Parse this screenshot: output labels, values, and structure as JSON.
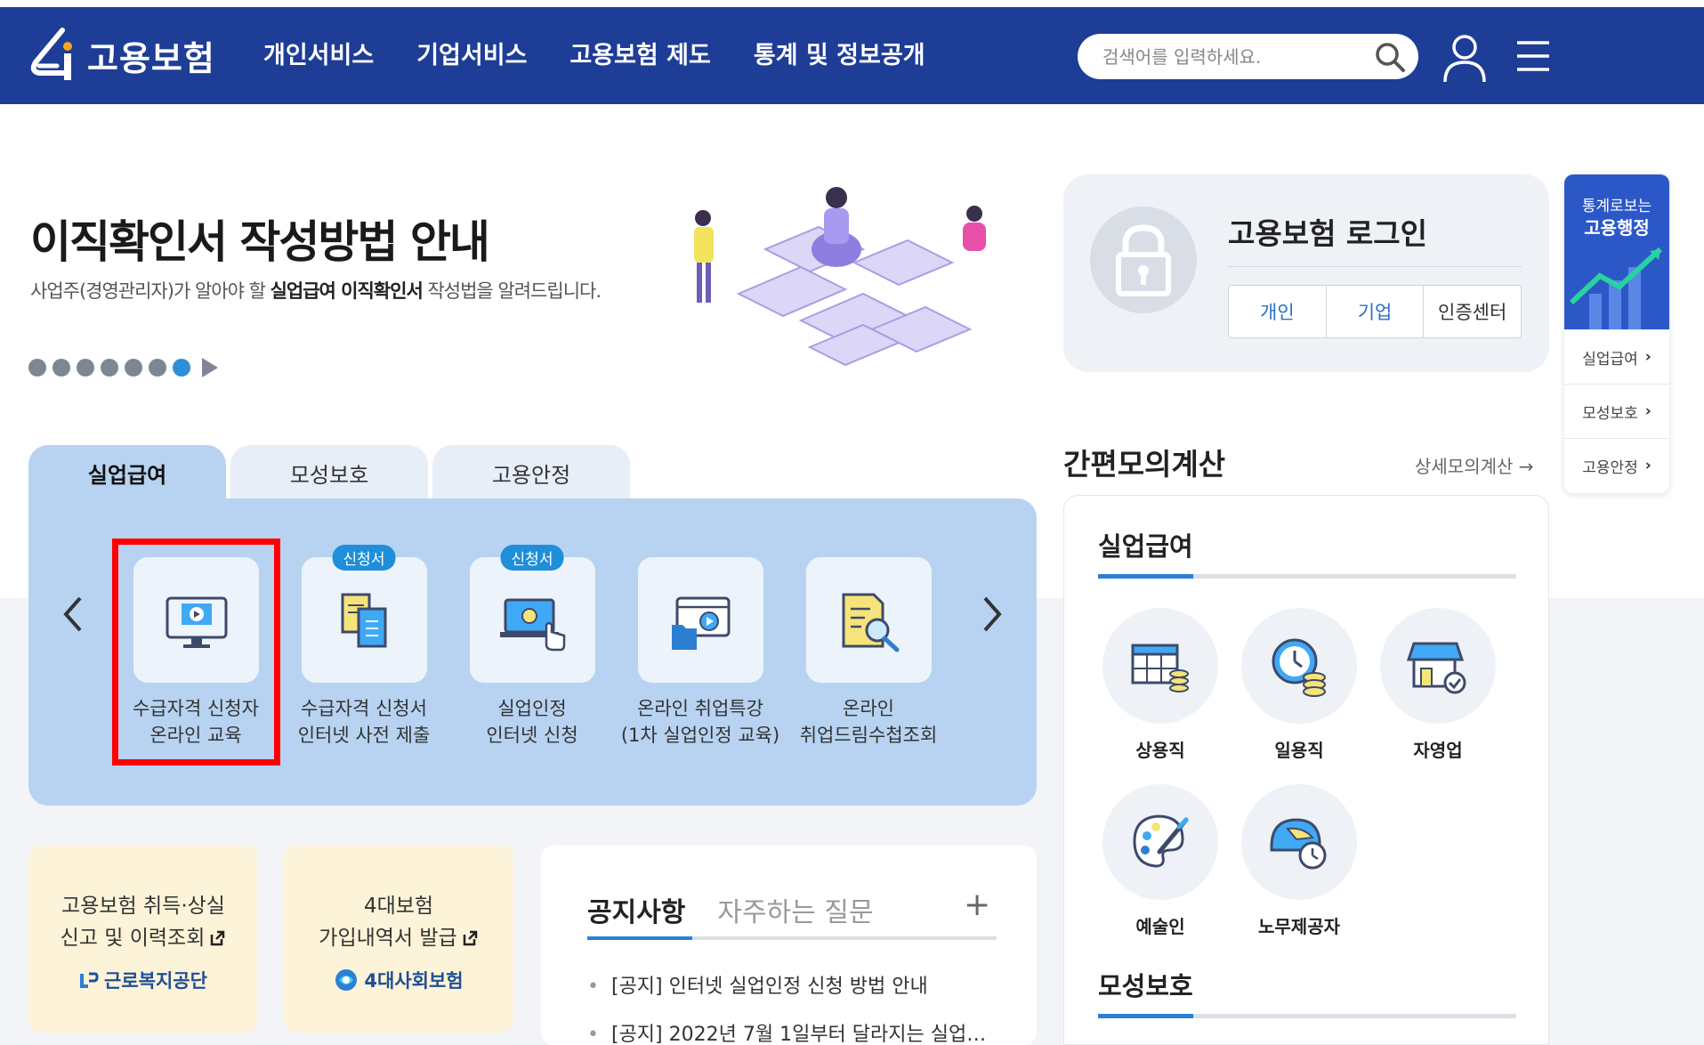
{
  "header": {
    "logo_text": "고용보험",
    "nav": [
      "개인서비스",
      "기업서비스",
      "고용보험 제도",
      "통계 및 정보공개"
    ],
    "search_placeholder": "검색어를 입력하세요."
  },
  "banner": {
    "title": "이직확인서 작성방법 안내",
    "subtitle_pre": "사업주(경영관리자)가 알아야 할 ",
    "subtitle_b1": "실업급여 이직확인서",
    "subtitle_post": " 작성법을 알려드립니다."
  },
  "login": {
    "title": "고용보험 로그인",
    "buttons": [
      "개인",
      "기업",
      "인증센터"
    ]
  },
  "side_widget": {
    "title_line1": "통계로보는",
    "title_line2": "고용행정",
    "items": [
      "실업급여",
      "모성보호",
      "고용안정"
    ]
  },
  "tabs": [
    "실업급여",
    "모성보호",
    "고용안정"
  ],
  "services": [
    {
      "line1": "수급자격 신청자",
      "line2": "온라인 교육",
      "badge": ""
    },
    {
      "line1": "수급자격 신청서",
      "line2": "인터넷 사전 제출",
      "badge": "신청서"
    },
    {
      "line1": "실업인정",
      "line2": "인터넷 신청",
      "badge": "신청서"
    },
    {
      "line1": "온라인 취업특강",
      "line2": "(1차 실업인정 교육)",
      "badge": ""
    },
    {
      "line1": "온라인",
      "line2": "취업드림수첩조회",
      "badge": ""
    }
  ],
  "cards": [
    {
      "line1": "고용보험 취득·상실",
      "line2": "신고 및 이력조회",
      "org": "근로복지공단"
    },
    {
      "line1": "4대보험",
      "line2": "가입내역서 발급",
      "org": "4대사회보험"
    }
  ],
  "notice": {
    "tabs": [
      "공지사항",
      "자주하는 질문"
    ],
    "plus": "+",
    "items": [
      "[공지] 인터넷 실업인정 신청 방법 안내",
      "[공지] 2022년 7월 1일부터 달라지는 실업인…"
    ]
  },
  "calc": {
    "title": "간편모의계산",
    "link": "상세모의계산",
    "section1": "실업급여",
    "items": [
      "상용직",
      "일용직",
      "자영업",
      "예술인",
      "노무제공자"
    ],
    "section2": "모성보호"
  },
  "colors": {
    "header": "#1e3d97",
    "accent": "#2b80d6",
    "tab_panel": "#b7d3f1",
    "badge": "#1f8fd9",
    "highlight": "#ff0000"
  }
}
